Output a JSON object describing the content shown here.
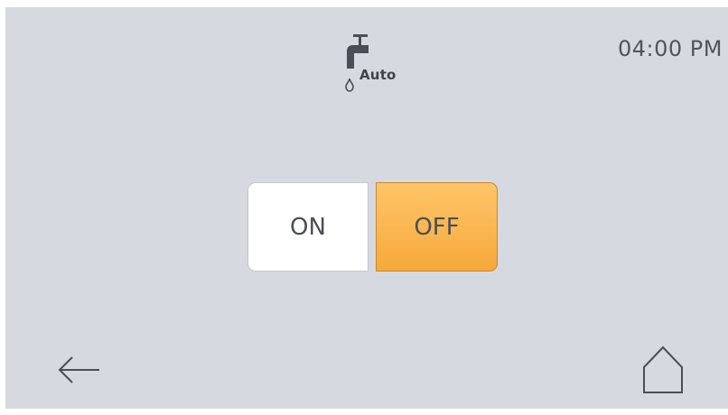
{
  "header": {
    "mode_icon": "faucet-drop-icon",
    "mode_label": "Auto",
    "time": "04:00 PM"
  },
  "toggle": {
    "on_label": "ON",
    "off_label": "OFF",
    "selected": "OFF",
    "selected_color": "#f6a93a"
  },
  "footer": {
    "back_icon": "arrow-left-icon",
    "home_icon": "home-icon"
  }
}
